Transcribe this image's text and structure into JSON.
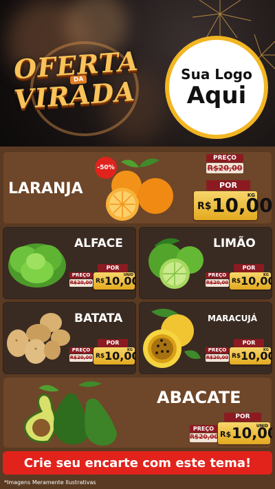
{
  "header": {
    "promo_title_line1": "OFERTA",
    "promo_title_small": "DA",
    "promo_title_line2": "VIRADA",
    "logo_line1": "Sua Logo",
    "logo_line2": "Aqui"
  },
  "featured": {
    "name": "LARANJA",
    "discount": "-50%",
    "preco_label": "PREÇO",
    "old_price": "R$20,00",
    "por_label": "POR",
    "currency": "R$",
    "price": "10,00",
    "unit": "KG"
  },
  "products": [
    {
      "name": "ALFACE",
      "preco_label": "PREÇO",
      "old_price": "R$20,00",
      "por_label": "POR",
      "currency": "R$",
      "price": "10,00",
      "unit": "UNID"
    },
    {
      "name": "LIMÃO",
      "preco_label": "PREÇO",
      "old_price": "R$20,00",
      "por_label": "POR",
      "currency": "R$",
      "price": "10,00",
      "unit": "KG"
    },
    {
      "name": "BATATA",
      "preco_label": "PREÇO",
      "old_price": "R$20,00",
      "por_label": "POR",
      "currency": "R$",
      "price": "10,00",
      "unit": "KG"
    },
    {
      "name": "MARACUJÁ",
      "preco_label": "PREÇO",
      "old_price": "R$20,00",
      "por_label": "POR",
      "currency": "R$",
      "price": "10,00",
      "unit": "KG"
    }
  ],
  "bottom": {
    "name": "ABACATE",
    "preco_label": "PREÇO",
    "old_price": "R$20,00",
    "por_label": "POR",
    "currency": "R$",
    "price": "10,00",
    "unit": "UNID"
  },
  "cta": "Crie seu encarte com este tema!",
  "footnote": "*Imagens Meramente Ilustrativas",
  "colors": {
    "brown": "#6e4629",
    "dark": "#3a2b22",
    "red": "#8c1b21",
    "gold": "#e3a920",
    "cta": "#e1231c"
  }
}
